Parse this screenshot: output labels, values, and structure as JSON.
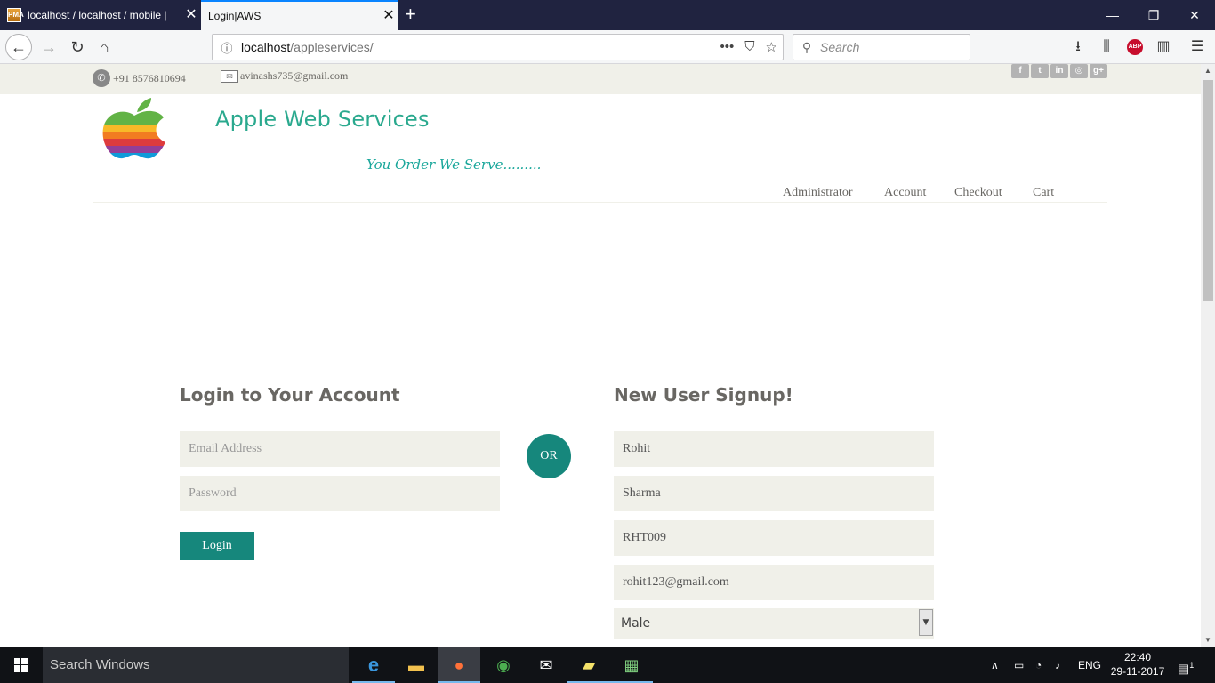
{
  "browser": {
    "tabs": [
      {
        "title": "localhost / localhost / mobile |",
        "active": false
      },
      {
        "title": "Login|AWS",
        "active": true
      }
    ],
    "url_host": "localhost",
    "url_path": "/appleservices/",
    "search_placeholder": "Search"
  },
  "site": {
    "phone": "+91 8576810694",
    "email": "avinashs735@gmail.com",
    "brand": "Apple Web Services",
    "tagline": "You Order We Serve.........",
    "menu": [
      "Administrator",
      "Account",
      "Checkout",
      "Cart"
    ]
  },
  "login": {
    "title": "Login to Your Account",
    "email_placeholder": "Email Address",
    "password_placeholder": "Password",
    "button": "Login"
  },
  "or_label": "OR",
  "signup": {
    "title": "New User Signup!",
    "first_name": "Rohit",
    "last_name": "Sharma",
    "user_id": "RHT009",
    "email": "rohit123@gmail.com",
    "gender": "Male"
  },
  "taskbar": {
    "search": "Search Windows",
    "lang": "ENG",
    "time": "22:40",
    "date": "29-11-2017",
    "notifications": "1"
  },
  "colors": {
    "accent": "#16877c",
    "brand_text": "#2aa98e",
    "strip": "#f0f0e9"
  }
}
